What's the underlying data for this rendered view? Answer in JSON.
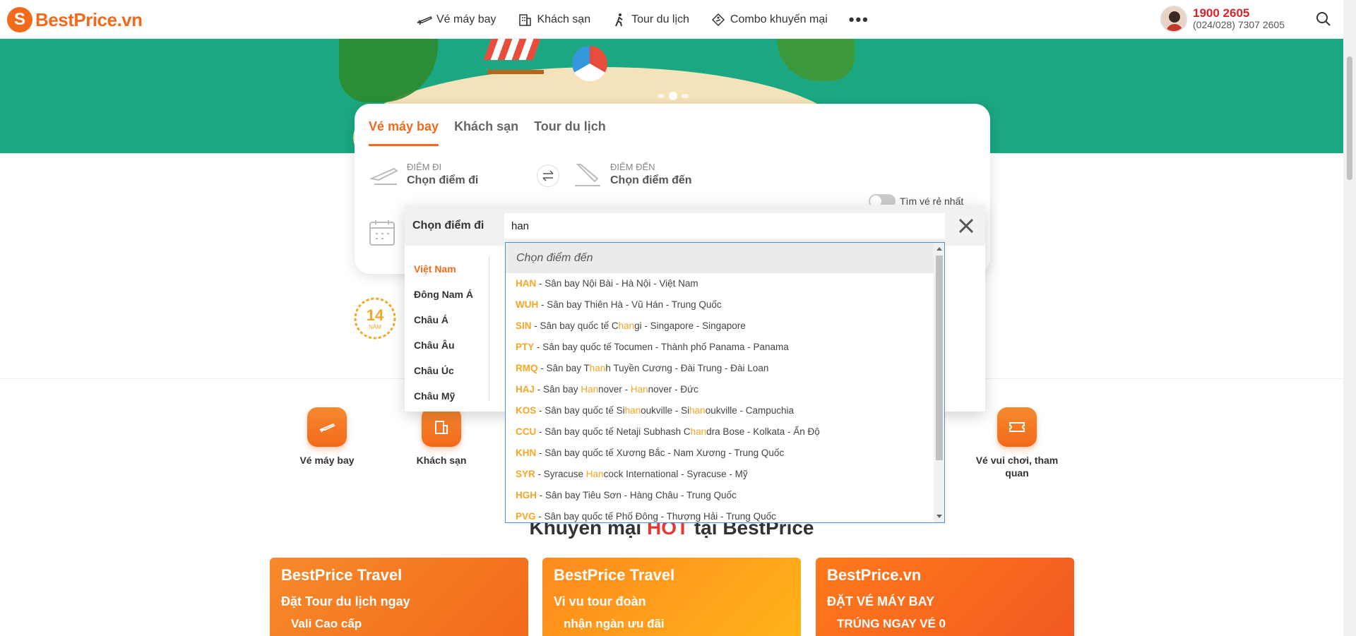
{
  "brand": {
    "name": "BestPrice.vn",
    "color": "#f26a1b"
  },
  "nav": {
    "items": [
      {
        "label": "Vé máy bay",
        "icon": "plane-icon"
      },
      {
        "label": "Khách sạn",
        "icon": "hotel-icon"
      },
      {
        "label": "Tour du lịch",
        "icon": "hiker-icon"
      },
      {
        "label": "Combo khuyến mại",
        "icon": "tag-icon"
      }
    ],
    "more": "•••"
  },
  "hotline": {
    "main": "1900 2605",
    "sub": "(024/028) 7307 2605"
  },
  "search_card": {
    "tabs": [
      "Vé máy bay",
      "Khách sạn",
      "Tour du lịch"
    ],
    "from": {
      "label": "Điểm đi",
      "value": "Chọn điểm đi"
    },
    "to": {
      "label": "Điểm đến",
      "value": "Chọn điểm đến"
    },
    "cheapest_toggle": "Tìm vé rẻ nhất"
  },
  "picker": {
    "title": "Chọn điểm đi",
    "query": "han",
    "regions": [
      "Việt Nam",
      "Đông Nam Á",
      "Châu Á",
      "Châu Âu",
      "Châu Úc",
      "Châu Mỹ"
    ],
    "active_region": 0
  },
  "results": {
    "header": "Chọn điểm đến",
    "items": [
      {
        "code": "HAN",
        "parts": [
          [
            " - Sân bay Nội Bài - Hà Nội - Việt Nam",
            false
          ]
        ]
      },
      {
        "code": "WUH",
        "parts": [
          [
            " - Sân bay Thiên Hà - Vũ Hán - Trung Quốc",
            false
          ]
        ]
      },
      {
        "code": "SIN",
        "parts": [
          [
            " - Sân bay quốc tế C",
            false
          ],
          [
            "han",
            true
          ],
          [
            "gi - Singapore - Singapore",
            false
          ]
        ]
      },
      {
        "code": "PTY",
        "parts": [
          [
            " - Sân bay quốc tế Tocumen - Thành phố Panama - Panama",
            false
          ]
        ]
      },
      {
        "code": "RMQ",
        "parts": [
          [
            " - Sân bay T",
            false
          ],
          [
            "han",
            true
          ],
          [
            "h Tuyền Cương - Đài Trung - Đài Loan",
            false
          ]
        ]
      },
      {
        "code": "HAJ",
        "parts": [
          [
            " - Sân bay ",
            false
          ],
          [
            "Han",
            true
          ],
          [
            "nover - ",
            false
          ],
          [
            "Han",
            true
          ],
          [
            "nover - Đức",
            false
          ]
        ]
      },
      {
        "code": "KOS",
        "parts": [
          [
            " - Sân bay quốc tế Si",
            false
          ],
          [
            "han",
            true
          ],
          [
            "oukville - Si",
            false
          ],
          [
            "han",
            true
          ],
          [
            "oukville - Campuchia",
            false
          ]
        ]
      },
      {
        "code": "CCU",
        "parts": [
          [
            " - Sân bay quốc tế Netaji Subhash C",
            false
          ],
          [
            "han",
            true
          ],
          [
            "dra Bose - Kolkata - Ấn Độ",
            false
          ]
        ]
      },
      {
        "code": "KHN",
        "parts": [
          [
            " - Sân bay quốc tế Xương Bắc - Nam Xương - Trung Quốc",
            false
          ]
        ]
      },
      {
        "code": "SYR",
        "parts": [
          [
            " - Syracuse ",
            false
          ],
          [
            "Han",
            true
          ],
          [
            "cock International - Syracuse - Mỹ",
            false
          ]
        ]
      },
      {
        "code": "HGH",
        "parts": [
          [
            " - Sân bay Tiêu Sơn - Hàng Châu - Trung Quốc",
            false
          ]
        ]
      },
      {
        "code": "PVG",
        "parts": [
          [
            " - Sân bay quốc tế Phố Đông - Thượng Hải - Trung Quốc",
            false
          ]
        ]
      }
    ]
  },
  "badge": {
    "number": "14",
    "unit": "NĂM"
  },
  "services": [
    {
      "label": "Vé máy bay",
      "icon": "plane-icon"
    },
    {
      "label": "Khách sạn",
      "icon": "hotel-icon"
    },
    {
      "label": "Vé vui chơi, tham quan",
      "icon": "ticket-icon"
    }
  ],
  "promo": {
    "prefix": "Khuyến mại ",
    "hot": "HOT",
    "suffix": " tại BestPrice"
  },
  "banners": [
    {
      "brand": "BestPrice Travel",
      "line1": "Đặt Tour du lịch ngay",
      "line2": "Vali Cao cấp"
    },
    {
      "brand": "BestPrice Travel",
      "line1": "Vi vu tour đoàn",
      "line2": "nhận ngàn ưu đãi"
    },
    {
      "brand": "BestPrice.vn",
      "line1": "ĐẶT VÉ MÁY BAY",
      "line2": "TRÚNG NGAY VÉ 0"
    }
  ]
}
